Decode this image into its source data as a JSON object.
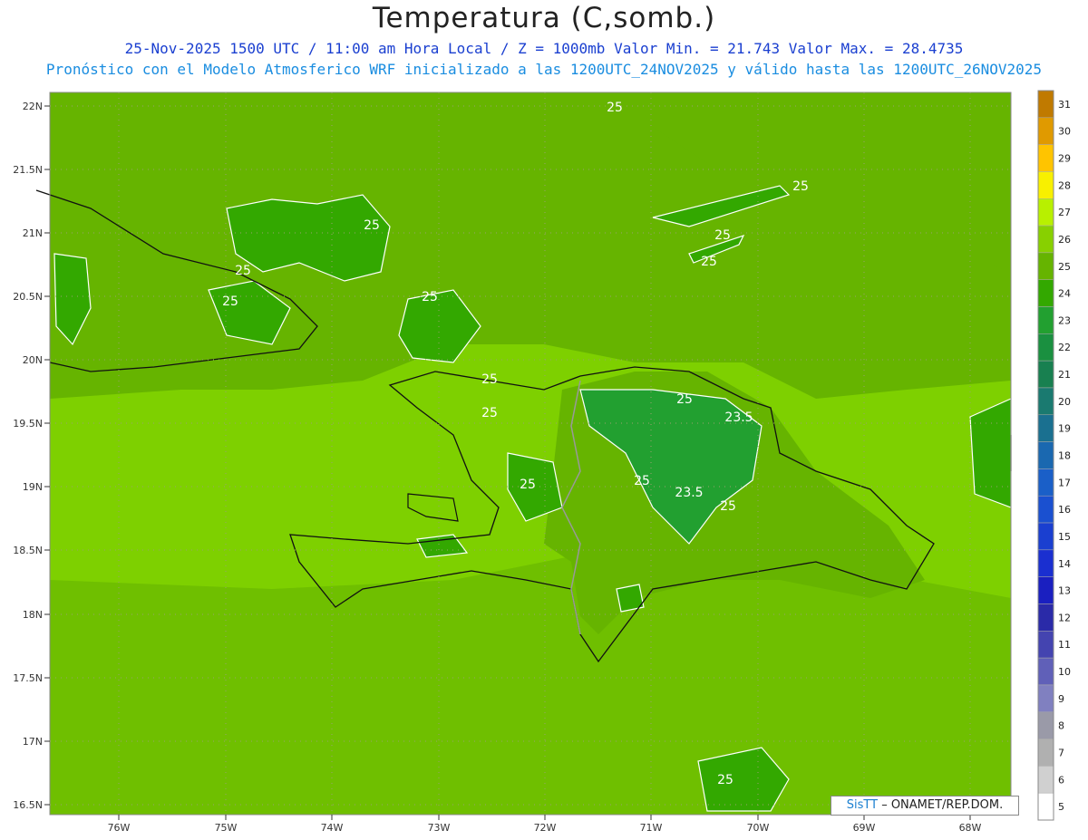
{
  "title": "Temperatura (C,somb.)",
  "subtitle_line1": "25-Nov-2025 1500 UTC / 11:00 am Hora Local / Z = 1000mb   Valor Min. = 21.743  Valor Max. = 28.4735",
  "subtitle_line2": "Pronóstico con el Modelo Atmosferico WRF inicializado a las 1200UTC_24NOV2025 y válido hasta las  1200UTC_26NOV2025",
  "lat_labels": [
    "22N",
    "21.5N",
    "21N",
    "20.5N",
    "20N",
    "19.5N",
    "19N",
    "18.5N",
    "18N",
    "17.5N",
    "17N",
    "16.5N"
  ],
  "lon_labels": [
    "76W",
    "75W",
    "74W",
    "73W",
    "72W",
    "71W",
    "70W",
    "69W",
    "68W"
  ],
  "contour_labels": [
    "25",
    "25",
    "25",
    "25",
    "25",
    "25",
    "25",
    "25",
    "25",
    "25",
    "25",
    "23.5",
    "25",
    "23.5",
    "25",
    "25",
    "25"
  ],
  "colorbar": {
    "levels": [
      "31",
      "30",
      "29",
      "28",
      "27",
      "26",
      "25",
      "24",
      "23",
      "22",
      "21",
      "20",
      "19",
      "18",
      "17",
      "16",
      "15",
      "14",
      "13",
      "12",
      "11",
      "10",
      "9",
      "8",
      "7",
      "6",
      "5"
    ],
    "colors": [
      "#c07a00",
      "#e09a00",
      "#ffc400",
      "#f8f000",
      "#b8f000",
      "#88d000",
      "#66b400",
      "#33a800",
      "#22a030",
      "#1a9040",
      "#188050",
      "#1a7a70",
      "#1a7090",
      "#1a68b0",
      "#1a5fc8",
      "#1a50d0",
      "#1a3fd0",
      "#1a2fd0",
      "#1a1fc0",
      "#2a2aa8",
      "#4444b0",
      "#6060b8",
      "#8080c0",
      "#9a9aa8",
      "#b0b0b0",
      "#d0d0d0",
      "#ffffff"
    ]
  },
  "watermark": {
    "brand": "SisTT",
    "text": " – ONAMET/REP.DOM."
  }
}
